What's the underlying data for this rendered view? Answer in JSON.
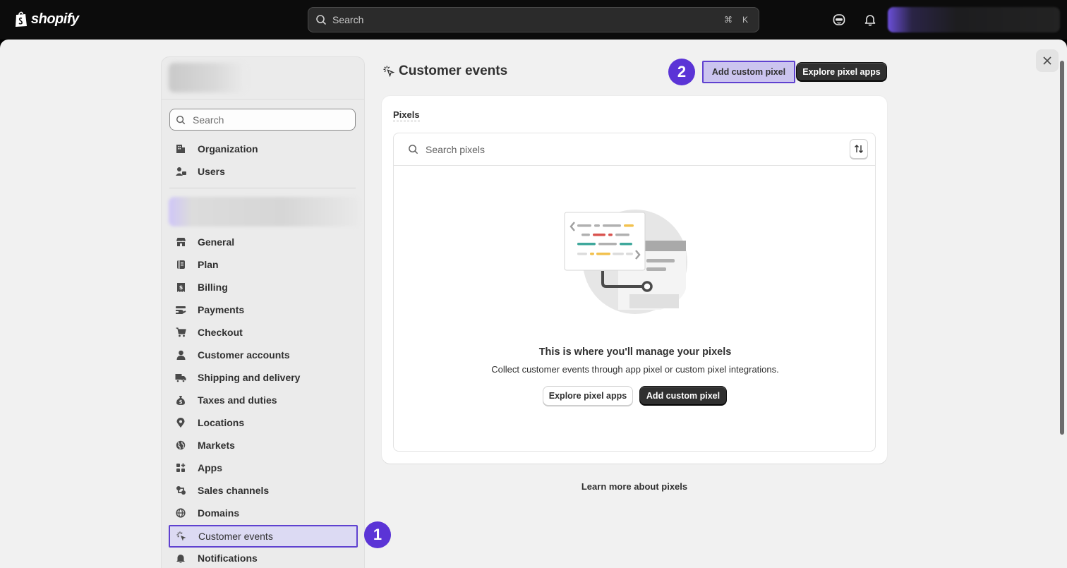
{
  "topbar": {
    "logo_text": "shopify",
    "search_placeholder": "Search",
    "shortcut_cmd": "⌘",
    "shortcut_key": "K"
  },
  "sidebar": {
    "search_placeholder": "Search",
    "group1": [
      {
        "label": "Organization",
        "icon": "building-icon"
      },
      {
        "label": "Users",
        "icon": "users-icon"
      }
    ],
    "group2": [
      {
        "label": "General",
        "icon": "store-icon"
      },
      {
        "label": "Plan",
        "icon": "plan-icon"
      },
      {
        "label": "Billing",
        "icon": "billing-icon"
      },
      {
        "label": "Payments",
        "icon": "payments-icon"
      },
      {
        "label": "Checkout",
        "icon": "cart-icon"
      },
      {
        "label": "Customer accounts",
        "icon": "person-icon"
      },
      {
        "label": "Shipping and delivery",
        "icon": "truck-icon"
      },
      {
        "label": "Taxes and duties",
        "icon": "tax-icon"
      },
      {
        "label": "Locations",
        "icon": "location-icon"
      },
      {
        "label": "Markets",
        "icon": "globe-icon"
      },
      {
        "label": "Apps",
        "icon": "apps-icon"
      },
      {
        "label": "Sales channels",
        "icon": "channels-icon"
      },
      {
        "label": "Domains",
        "icon": "domain-icon"
      },
      {
        "label": "Customer events",
        "icon": "cursor-click-icon",
        "active": true
      },
      {
        "label": "Notifications",
        "icon": "bell-icon"
      }
    ]
  },
  "badges": {
    "one": "1",
    "two": "2"
  },
  "main": {
    "title": "Customer events",
    "add_custom_pixel": "Add custom pixel",
    "explore_pixel_apps": "Explore pixel apps",
    "card": {
      "title": "Pixels",
      "search_placeholder": "Search pixels",
      "empty_title": "This is where you'll manage your pixels",
      "empty_subtitle": "Collect customer events through app pixel or custom pixel integrations.",
      "explore_label": "Explore pixel apps",
      "add_label": "Add custom pixel"
    },
    "learn_more": "Learn more about pixels"
  },
  "colors": {
    "highlight": "#5f41d0",
    "badge": "#5b34d6",
    "dark_button": "#303030"
  }
}
